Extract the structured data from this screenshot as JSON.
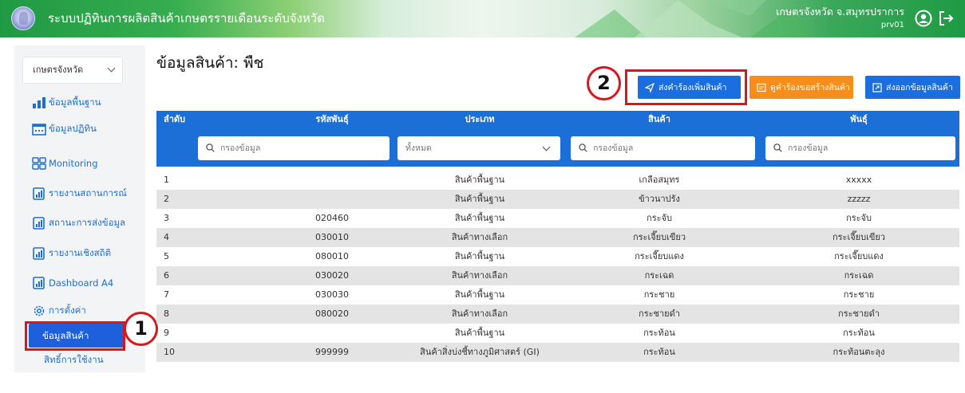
{
  "header": {
    "title": "ระบบปฏิทินการผลิตสินค้าเกษตรรายเดือนระดับจังหวัด",
    "user_name": "เกษตรจังหวัด จ.สมุทรปราการ",
    "user_id": "prv01",
    "logo": "provincial-seal",
    "icons": [
      "user-circle-icon",
      "logout-icon"
    ]
  },
  "sidebar": {
    "role_select": "เกษตรจังหวัด",
    "items": [
      {
        "label": "ข้อมูลพื้นฐาน",
        "icon": "bar-chart-icon"
      },
      {
        "label": "ข้อมูลปฏิทิน",
        "icon": "calendar-icon"
      },
      {
        "label": "Monitoring",
        "icon": "grid-icon"
      },
      {
        "label": "รายงานสถานการณ์",
        "icon": "report-icon"
      },
      {
        "label": "สถานะการส่งข้อมูล",
        "icon": "report-icon"
      },
      {
        "label": "รายงานเชิงสถิติ",
        "icon": "report-icon"
      },
      {
        "label": "Dashboard A4",
        "icon": "report-icon"
      },
      {
        "label": "การตั้งค่า",
        "icon": "gear-icon"
      }
    ],
    "active_item": "ข้อมูลสินค้า",
    "sub_item": "สิทธิ์การใช้งาน"
  },
  "callouts": [
    "1",
    "2"
  ],
  "main": {
    "title": "ข้อมูลสินค้า: พืช",
    "buttons": {
      "request_add": "ส่งคำร้องเพิ่มสินค้า",
      "view_requests": "ดูคำร้องขอสร้างสินค้า",
      "export": "ส่งออกข้อมูลสินค้า"
    },
    "colors": {
      "primary": "#1b6fd6",
      "accent_orange": "#f78d1b",
      "active_menu": "#1e5fdc",
      "callout": "#d9161c"
    }
  },
  "table": {
    "columns": [
      "ลำดับ",
      "รหัสพันธุ์",
      "ประเภท",
      "สินค้า",
      "พันธุ์"
    ],
    "filters": {
      "code_placeholder": "กรองข้อมูล",
      "type_selected": "ทั้งหมด",
      "name_placeholder": "กรองข้อมูล",
      "variety_placeholder": "กรองข้อมูล"
    },
    "rows": [
      {
        "idx": "1",
        "code": "",
        "type": "สินค้าพื้นฐาน",
        "name": "เกลือสมุทร",
        "variety": "xxxxx"
      },
      {
        "idx": "2",
        "code": "",
        "type": "สินค้าพื้นฐาน",
        "name": "ข้าวนาปรัง",
        "variety": "zzzzz"
      },
      {
        "idx": "3",
        "code": "020460",
        "type": "สินค้าพื้นฐาน",
        "name": "กระจับ",
        "variety": "กระจับ"
      },
      {
        "idx": "4",
        "code": "030010",
        "type": "สินค้าทางเลือก",
        "name": "กระเจี๊ยบเขียว",
        "variety": "กระเจี๊ยบเขียว"
      },
      {
        "idx": "5",
        "code": "080010",
        "type": "สินค้าพื้นฐาน",
        "name": "กระเจี๊ยบแดง",
        "variety": "กระเจี๊ยบแดง"
      },
      {
        "idx": "6",
        "code": "030020",
        "type": "สินค้าทางเลือก",
        "name": "กระเฉด",
        "variety": "กระเฉด"
      },
      {
        "idx": "7",
        "code": "030030",
        "type": "สินค้าพื้นฐาน",
        "name": "กระชาย",
        "variety": "กระชาย"
      },
      {
        "idx": "8",
        "code": "080020",
        "type": "สินค้าทางเลือก",
        "name": "กระชายดำ",
        "variety": "กระชายดำ"
      },
      {
        "idx": "9",
        "code": "",
        "type": "สินค้าพื้นฐาน",
        "name": "กระท้อน",
        "variety": "กระท้อน"
      },
      {
        "idx": "10",
        "code": "999999",
        "type": "สินค้าสิ่งบ่งชี้ทางภูมิศาสตร์ (GI)",
        "name": "กระท้อน",
        "variety": "กระท้อนตะลุง"
      }
    ]
  }
}
